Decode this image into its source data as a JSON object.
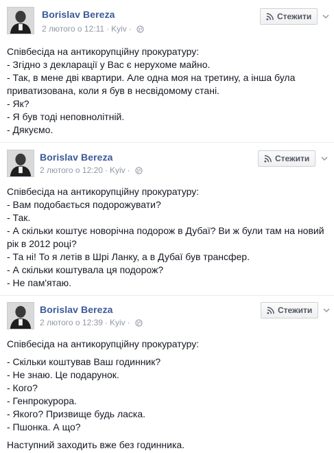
{
  "posts": [
    {
      "author": "Borislav Bereza",
      "date": "2 лютого о 12:11",
      "location": "Kyiv",
      "follow_label": "Стежити",
      "lines": [
        "Співбесіда на антикорупційну прокуратуру:",
        "- Згідно з декларації у Вас є нерухоме майно.",
        "- Так, в мене дві квартири. Але одна моя на третину, а інша була приватизована, коли я був в несвідомому стані.",
        "- Як?",
        "- Я був тоді неповнолітній.",
        "- Дякуємо."
      ]
    },
    {
      "author": "Borislav Bereza",
      "date": "2 лютого о 12:20",
      "location": "Kyiv",
      "follow_label": "Стежити",
      "lines": [
        "Співбесіда на антикорупційну прокуратуру:",
        "- Вам подобається подорожувати?",
        "- Так.",
        "- А скільки коштує новорічна подорож в Дубаї? Ви ж були там на новий рік в 2012 році?",
        "- Та ні! То я летів в Шрі Ланку, а в Дубаї був трансфер.",
        "- А скільки коштувала ця подорож?",
        "- Не пам'ятаю."
      ]
    },
    {
      "author": "Borislav Bereza",
      "date": "2 лютого о 12:39",
      "location": "Kyiv",
      "follow_label": "Стежити",
      "intro": "Співбесіда на антикорупційну прокуратуру:",
      "lines": [
        "- Скільки коштував Ваш годинник?",
        "- Не знаю. Це подарунок.",
        "- Кого?",
        "- Генпрокурора.",
        "- Якого? Призвище будь ласка.",
        "- Пшонка. А що?"
      ],
      "outro": "Наступний заходить вже без годинника."
    }
  ]
}
